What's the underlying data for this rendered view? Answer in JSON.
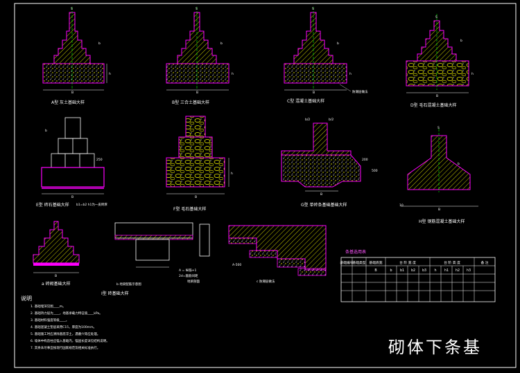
{
  "sheet": {
    "title": "砌体下条基",
    "colors": {
      "background": "#000000",
      "frame": "#ffffff",
      "masonry_outline": "#ff00ff",
      "hatch": "#ffff00",
      "axis": "#00ff00",
      "table_title": "#ff55ff"
    }
  },
  "details": {
    "a": {
      "caption": "A型 灰土基础大样",
      "label_s": "S",
      "label_b": "b",
      "label_B": "B",
      "dim_h": "h"
    },
    "b": {
      "caption": "B型 三合土基础大样",
      "label_s": "S",
      "label_b": "b",
      "label_B": "B",
      "dim_h": "h"
    },
    "c": {
      "caption": "C型 混凝土基础大样",
      "label_s": "S",
      "label_b": "b",
      "label_B": "B",
      "dim_h": "h",
      "callout": "防潮层做法"
    },
    "d": {
      "caption": "D型 毛石混凝土基础大样",
      "label_s": "S",
      "label_b": "b",
      "label_B": "B",
      "dim_h": "h"
    },
    "e": {
      "caption": "E型 砖石基础大样",
      "label_b": "b",
      "label_B": "B",
      "dim_250": "250",
      "extra": "b1=b2 h1为一皮砖厚"
    },
    "f": {
      "caption": "F型 毛石基础大样",
      "label_B": "B",
      "dim_h": "h"
    },
    "g": {
      "caption": "G型 单砖条基础基础大样",
      "top_left": "b/2",
      "top_right": "b/2",
      "dim_200": "200",
      "dim_500": "500",
      "label_B": "B"
    },
    "h": {
      "caption": "H型 钢筋混凝土基础大样",
      "label_s": "S",
      "label_b": "b",
      "label_B": "B",
      "dim_10": "10"
    },
    "i": {
      "caption": "a 砖砌基础大样",
      "label_B": "B"
    },
    "j": {
      "caption": "I型 砖基础大样",
      "sub": "b 地梁配筋示意图"
    },
    "k": {
      "caption": "地梁剖面",
      "formula": "A = 纵筋+1",
      "formula2": "2d=箍筋间距"
    },
    "l": {
      "caption": "c 防潮层做法",
      "label": "A-500"
    }
  },
  "table": {
    "title": "条基选用表",
    "headers": [
      "基础编号",
      "基础类型",
      "基础底宽",
      "台 阶 宽 度",
      "台 阶 高 度",
      "备 注"
    ],
    "subheaders": [
      "B",
      "b",
      "b1",
      "b2",
      "b3",
      "h",
      "h1",
      "h2",
      "h3"
    ]
  },
  "notes": {
    "title": "说明",
    "items": [
      "1. 基础埋深见图____m。",
      "2. 基础持力层为____，地基承载力特征值____kPa。",
      "3. 基础材料强度等级____。",
      "4. 基础混凝土垫层采用C15，厚度为100mm。",
      "5. 基础施工时应清除基底浮土，遇墓穴等应处理。",
      "6. 墙体中构造柱应锚入基础内，锚固长度详见结构说明。",
      "7. 其余未尽事宜按现行国家规范及相关标准执行。"
    ]
  }
}
